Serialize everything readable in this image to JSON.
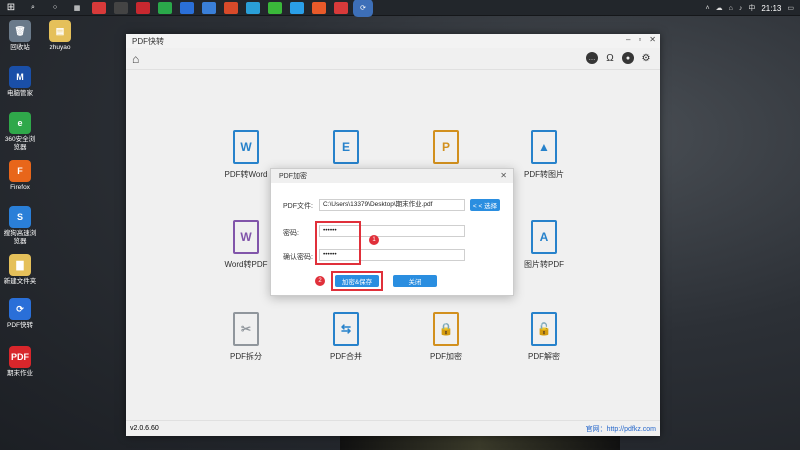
{
  "taskbar": {
    "clock": "21:13",
    "ime": "中"
  },
  "desktop": {
    "icons": [
      {
        "label": "回收站",
        "glyph": "🗑",
        "color": "#6a7a8a"
      },
      {
        "label": "电脑管家",
        "glyph": "M",
        "color": "#1a4fa8"
      },
      {
        "label": "360安全浏览器",
        "glyph": "e",
        "color": "#2fa84a"
      },
      {
        "label": "Firefox",
        "glyph": "F",
        "color": "#e8661a"
      },
      {
        "label": "搜狗高速浏览器",
        "glyph": "S",
        "color": "#2a7fd8"
      },
      {
        "label": "新建文件夹",
        "glyph": "▇",
        "color": "#e5c05a"
      },
      {
        "label": "PDF快转",
        "glyph": "⟳",
        "color": "#2a6fd8"
      },
      {
        "label": "期末作业",
        "glyph": "PDF",
        "color": "#d8262b"
      }
    ],
    "icon2": {
      "label": "zhuyao",
      "glyph": "▤",
      "color": "#e5c05a"
    }
  },
  "app": {
    "title": "PDF快转",
    "version": "v2.0.6.60",
    "website": "官网：http://pdfkz.com",
    "features": [
      {
        "label": "PDF转Word",
        "letter": "W"
      },
      {
        "label": "",
        "letter": "E"
      },
      {
        "label": "",
        "letter": "P"
      },
      {
        "label": "PDF转图片",
        "letter": "▲"
      },
      {
        "label": "Word转PDF",
        "letter": "W"
      },
      {
        "label": "图片转PDF",
        "letter": "A"
      },
      {
        "label": "PDF拆分",
        "letter": "✂"
      },
      {
        "label": "PDF合并",
        "letter": "⇆"
      },
      {
        "label": "PDF加密",
        "letter": "🔒"
      },
      {
        "label": "PDF解密",
        "letter": "🔓"
      }
    ]
  },
  "dialog": {
    "title": "PDF加密",
    "file_label": "PDF文件:",
    "file_value": "C:\\Users\\13379\\Desktop\\期末作业.pdf",
    "select_button": "< < 选择",
    "password_label": "密码:",
    "password_value": "••••••",
    "confirm_label": "确认密码:",
    "confirm_value": "••••••",
    "encrypt_button": "加密&保存",
    "close_button": "关闭",
    "badge1": "1",
    "badge2": "2"
  }
}
